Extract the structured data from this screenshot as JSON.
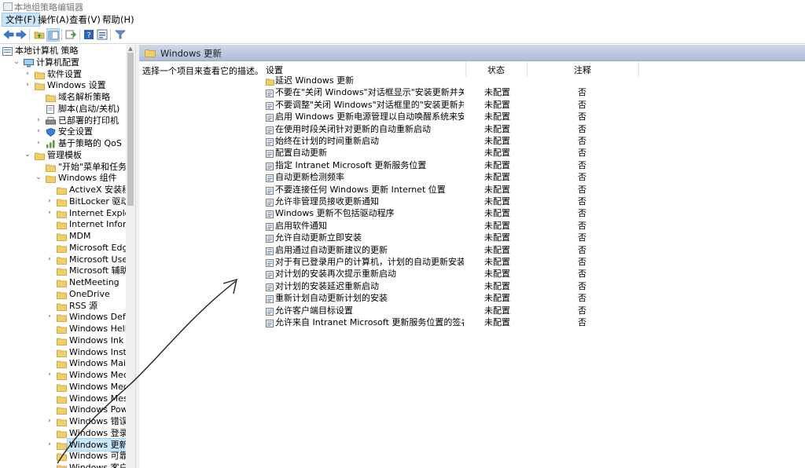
{
  "window": {
    "title": "本地组策略编辑器"
  },
  "menu": [
    {
      "label": "文件(F)",
      "active": true
    },
    {
      "label": "操作(A)"
    },
    {
      "label": "查看(V)"
    },
    {
      "label": "帮助(H)"
    }
  ],
  "toolbar": {
    "buttons": [
      "back-icon",
      "forward-icon",
      "up-folder-icon",
      "show-hide-tree-icon",
      "export-list-icon",
      "help-icon",
      "properties-icon",
      "filter-icon"
    ]
  },
  "tree": {
    "rows": [
      {
        "label": "本地计算机 策略",
        "level": 0,
        "exp": "",
        "icon": "policy"
      },
      {
        "label": "计算机配置",
        "level": 1,
        "exp": "open",
        "icon": "computer"
      },
      {
        "label": "软件设置",
        "level": 2,
        "exp": "closed",
        "icon": "folder"
      },
      {
        "label": "Windows 设置",
        "level": 2,
        "exp": "closed",
        "icon": "folder"
      },
      {
        "label": "域名解析策略",
        "level": 3,
        "exp": "",
        "icon": "folder"
      },
      {
        "label": "脚本(启动/关机)",
        "level": 3,
        "exp": "",
        "icon": "script"
      },
      {
        "label": "已部署的打印机",
        "level": 3,
        "exp": "closed",
        "icon": "printer"
      },
      {
        "label": "安全设置",
        "level": 3,
        "exp": "closed",
        "icon": "security"
      },
      {
        "label": "基于策略的 QoS",
        "level": 3,
        "exp": "closed",
        "icon": "qos"
      },
      {
        "label": "管理模板",
        "level": 2,
        "exp": "open",
        "icon": "folder"
      },
      {
        "label": "\"开始\"菜单和任务栏",
        "level": 3,
        "exp": "",
        "icon": "folder"
      },
      {
        "label": "Windows 组件",
        "level": 3,
        "exp": "open",
        "icon": "folder"
      },
      {
        "label": "ActiveX 安装程序服务",
        "level": 4,
        "exp": "",
        "icon": "folder"
      },
      {
        "label": "BitLocker 驱动器加密",
        "level": 4,
        "exp": "closed",
        "icon": "folder"
      },
      {
        "label": "Internet Explorer",
        "level": 4,
        "exp": "closed",
        "icon": "folder"
      },
      {
        "label": "Internet Information",
        "level": 4,
        "exp": "",
        "icon": "folder"
      },
      {
        "label": "MDM",
        "level": 4,
        "exp": "",
        "icon": "folder"
      },
      {
        "label": "Microsoft Edge",
        "level": 4,
        "exp": "",
        "icon": "folder"
      },
      {
        "label": "Microsoft User Expe",
        "level": 4,
        "exp": "closed",
        "icon": "folder"
      },
      {
        "label": "Microsoft 辅助身份验",
        "level": 4,
        "exp": "",
        "icon": "folder"
      },
      {
        "label": "NetMeeting",
        "level": 4,
        "exp": "",
        "icon": "folder"
      },
      {
        "label": "OneDrive",
        "level": 4,
        "exp": "",
        "icon": "folder"
      },
      {
        "label": "RSS 源",
        "level": 4,
        "exp": "",
        "icon": "folder"
      },
      {
        "label": "Windows Defender",
        "level": 4,
        "exp": "closed",
        "icon": "folder"
      },
      {
        "label": "Windows Hello for B",
        "level": 4,
        "exp": "",
        "icon": "folder"
      },
      {
        "label": "Windows Ink 工作区",
        "level": 4,
        "exp": "",
        "icon": "folder"
      },
      {
        "label": "Windows Installer",
        "level": 4,
        "exp": "",
        "icon": "folder"
      },
      {
        "label": "Windows Mail",
        "level": 4,
        "exp": "",
        "icon": "folder"
      },
      {
        "label": "Windows Media Pla",
        "level": 4,
        "exp": "closed",
        "icon": "folder"
      },
      {
        "label": "Windows Media 数字",
        "level": 4,
        "exp": "",
        "icon": "folder"
      },
      {
        "label": "Windows Messenger",
        "level": 4,
        "exp": "",
        "icon": "folder"
      },
      {
        "label": "Windows PowerShell",
        "level": 4,
        "exp": "",
        "icon": "folder"
      },
      {
        "label": "Windows 错误报告",
        "level": 4,
        "exp": "closed",
        "icon": "folder"
      },
      {
        "label": "Windows 登录选项",
        "level": 4,
        "exp": "",
        "icon": "folder"
      },
      {
        "label": "Windows 更新",
        "level": 4,
        "exp": "closed",
        "icon": "folder",
        "selected": true
      },
      {
        "label": "Windows 可靠性分析",
        "level": 4,
        "exp": "",
        "icon": "folder"
      },
      {
        "label": "Windows 客户体验改",
        "level": 4,
        "exp": "",
        "icon": "folder"
      }
    ]
  },
  "pane": {
    "title": "Windows 更新",
    "description": "选择一个项目来查看它的描述。",
    "columns": {
      "setting": "设置",
      "state": "状态",
      "comment": "注释"
    },
    "rows": [
      {
        "name": "延迟 Windows 更新",
        "state": "",
        "comment": "",
        "icon": "folder"
      },
      {
        "name": "不要在\"关闭 Windows\"对话框显示\"安装更新并关机\"",
        "state": "未配置",
        "comment": "否",
        "icon": "setting"
      },
      {
        "name": "不要调整\"关闭 Windows\"对话框里的\"安装更新并关机\"的默...",
        "state": "未配置",
        "comment": "否",
        "icon": "setting"
      },
      {
        "name": "启用 Windows 更新电源管理以自动唤醒系统来安装计划的...",
        "state": "未配置",
        "comment": "否",
        "icon": "setting"
      },
      {
        "name": "在使用时段关闭针对更新的自动重新启动",
        "state": "未配置",
        "comment": "否",
        "icon": "setting"
      },
      {
        "name": "始终在计划的时间重新启动",
        "state": "未配置",
        "comment": "否",
        "icon": "setting"
      },
      {
        "name": "配置自动更新",
        "state": "未配置",
        "comment": "否",
        "icon": "setting"
      },
      {
        "name": "指定 Intranet Microsoft 更新服务位置",
        "state": "未配置",
        "comment": "否",
        "icon": "setting"
      },
      {
        "name": "自动更新检测频率",
        "state": "未配置",
        "comment": "否",
        "icon": "setting"
      },
      {
        "name": "不要连接任何 Windows 更新 Internet 位置",
        "state": "未配置",
        "comment": "否",
        "icon": "setting"
      },
      {
        "name": "允许非管理员接收更新通知",
        "state": "未配置",
        "comment": "否",
        "icon": "setting"
      },
      {
        "name": "Windows 更新不包括驱动程序",
        "state": "未配置",
        "comment": "否",
        "icon": "setting"
      },
      {
        "name": "启用软件通知",
        "state": "未配置",
        "comment": "否",
        "icon": "setting"
      },
      {
        "name": "允许自动更新立即安装",
        "state": "未配置",
        "comment": "否",
        "icon": "setting"
      },
      {
        "name": "启用通过自动更新建议的更新",
        "state": "未配置",
        "comment": "否",
        "icon": "setting"
      },
      {
        "name": "对于有已登录用户的计算机，计划的自动更新安装不执行重...",
        "state": "未配置",
        "comment": "否",
        "icon": "setting"
      },
      {
        "name": "对计划的安装再次提示重新启动",
        "state": "未配置",
        "comment": "否",
        "icon": "setting"
      },
      {
        "name": "对计划的安装延迟重新启动",
        "state": "未配置",
        "comment": "否",
        "icon": "setting"
      },
      {
        "name": "重新计划自动更新计划的安装",
        "state": "未配置",
        "comment": "否",
        "icon": "setting"
      },
      {
        "name": "允许客户端目标设置",
        "state": "未配置",
        "comment": "否",
        "icon": "setting"
      },
      {
        "name": "允许来自 Intranet Microsoft 更新服务位置的签名更新",
        "state": "未配置",
        "comment": "否",
        "icon": "setting"
      }
    ]
  }
}
